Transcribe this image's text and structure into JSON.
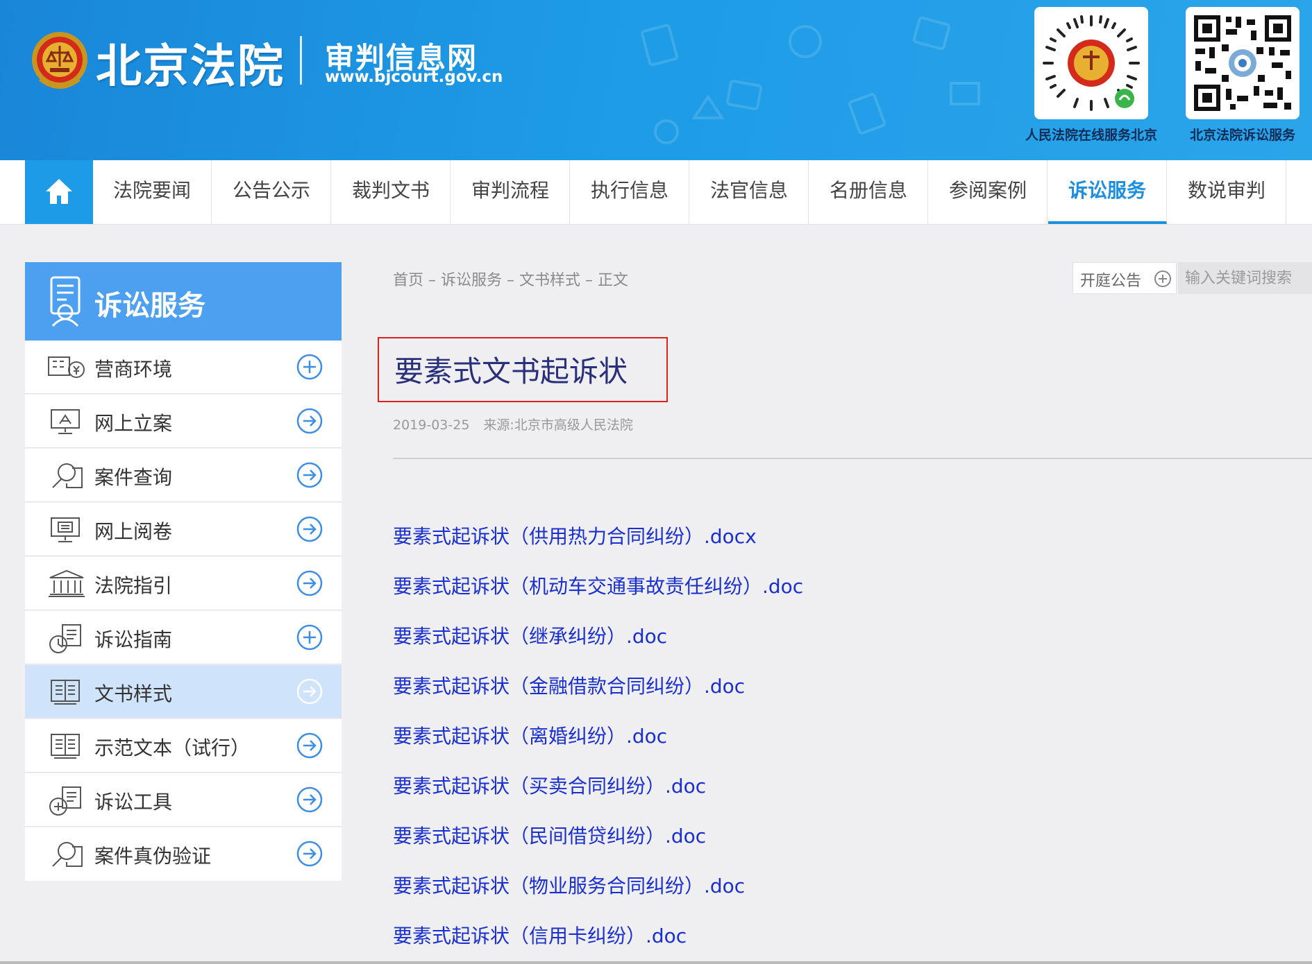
{
  "header": {
    "logo_main": "北京法院",
    "logo_sub": "审判信息网",
    "logo_url": "www.bjcourt.gov.cn",
    "qr_codes": [
      {
        "label": "人民法院在线服务北京",
        "icon": "mini-program-qr-icon"
      },
      {
        "label": "北京法院诉讼服务",
        "icon": "qr-code-icon"
      }
    ]
  },
  "nav": {
    "home_icon": "home-icon",
    "items": [
      {
        "label": "法院要闻"
      },
      {
        "label": "公告公示"
      },
      {
        "label": "裁判文书"
      },
      {
        "label": "审判流程"
      },
      {
        "label": "执行信息"
      },
      {
        "label": "法官信息"
      },
      {
        "label": "名册信息"
      },
      {
        "label": "参阅案例"
      },
      {
        "label": "诉讼服务",
        "active": true
      },
      {
        "label": "数说审判"
      }
    ]
  },
  "sidebar": {
    "title": "诉讼服务",
    "items": [
      {
        "label": "营商环境",
        "icon": "business-environment-icon",
        "action": "expand"
      },
      {
        "label": "网上立案",
        "icon": "online-filing-icon",
        "action": "go"
      },
      {
        "label": "案件查询",
        "icon": "case-search-icon",
        "action": "go"
      },
      {
        "label": "网上阅卷",
        "icon": "online-file-review-icon",
        "action": "go"
      },
      {
        "label": "法院指引",
        "icon": "court-building-icon",
        "action": "go"
      },
      {
        "label": "诉讼指南",
        "icon": "litigation-guide-icon",
        "action": "expand"
      },
      {
        "label": "文书样式",
        "icon": "document-template-icon",
        "action": "go",
        "active": true
      },
      {
        "label": "示范文本（试行）",
        "icon": "sample-text-icon",
        "action": "go"
      },
      {
        "label": "诉讼工具",
        "icon": "litigation-tools-icon",
        "action": "go"
      },
      {
        "label": "案件真伪验证",
        "icon": "case-verify-icon",
        "action": "go"
      }
    ]
  },
  "content": {
    "breadcrumb": "首页 – 诉讼服务 – 文书样式 – 正文",
    "notice_label": "开庭公告",
    "search_placeholder": "输入关键词搜索",
    "title": "要素式文书起诉状",
    "date": "2019-03-25",
    "source": "来源:北京市高级人民法院",
    "files": [
      "要素式起诉状（供用热力合同纠纷）.docx",
      "要素式起诉状（机动车交通事故责任纠纷）.doc",
      "要素式起诉状（继承纠纷）.doc",
      "要素式起诉状（金融借款合同纠纷）.doc",
      "要素式起诉状（离婚纠纷）.doc",
      "要素式起诉状（买卖合同纠纷）.doc",
      "要素式起诉状（民间借贷纠纷）.doc",
      "要素式起诉状（物业服务合同纠纷）.doc",
      "要素式起诉状（信用卡纠纷）.doc"
    ]
  },
  "colors": {
    "header_blue": "#1d9be6",
    "sidebar_head_blue": "#4d9fef",
    "active_nav": "#1d8fe0",
    "link_blue": "#1a2fd0",
    "title_navy": "#2a2f7a",
    "highlight_red": "#e0201c"
  }
}
